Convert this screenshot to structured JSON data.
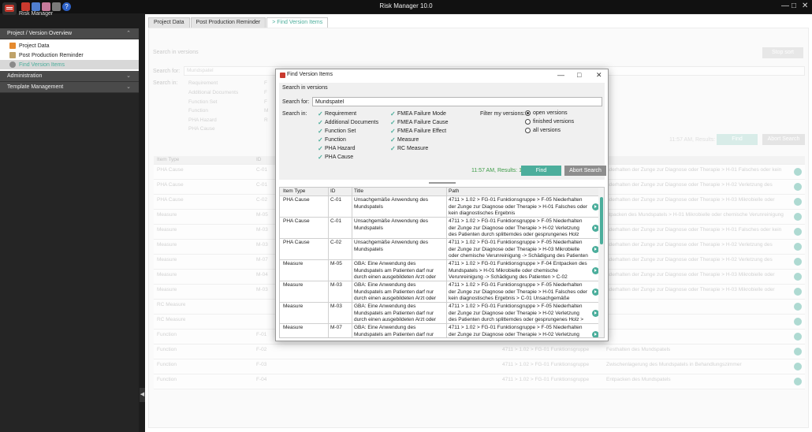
{
  "window": {
    "title": "Risk Manager  10.0",
    "app_name": "Risk Manager"
  },
  "sidebar": {
    "sections": [
      {
        "label": "Project / Version Overview",
        "expanded": true
      },
      {
        "label": "Administration",
        "expanded": false
      },
      {
        "label": "Template Management",
        "expanded": false
      }
    ],
    "items": [
      {
        "label": "Project Data",
        "active": false
      },
      {
        "label": "Post Production Reminder",
        "active": false
      },
      {
        "label": "Find Version Items",
        "active": true
      }
    ]
  },
  "tabs": [
    {
      "label": "Project Data",
      "active": false
    },
    {
      "label": "Post Production Reminder",
      "active": false
    },
    {
      "label": "> Find Version Items",
      "active": true
    }
  ],
  "background": {
    "section_title": "Search in versions",
    "stop_sort": "Stop sort",
    "search_for_label": "Search for:",
    "search_value": "Mundspatel",
    "search_in_label": "Search in:",
    "checks": [
      "Requirement",
      "Additional Documents",
      "Function Set",
      "Function",
      "PHA Hazard",
      "PHA Cause"
    ],
    "checks_col2": [
      "F",
      "F",
      "F",
      "M",
      "R"
    ],
    "status": "11:57 AM, Results: 16",
    "find": "Find",
    "abort": "Abort Search",
    "grid": {
      "headers": [
        "Item Type",
        "ID"
      ],
      "rows": [
        [
          "PHA Cause",
          "C-01",
          "nderhalten der Zunge zur Diagnose oder Therapie > H-01 Falsches oder kein"
        ],
        [
          "PHA Cause",
          "C-01",
          "nderhalten der Zunge zur Diagnose oder Therapie > H-02 Verletzung des"
        ],
        [
          "PHA Cause",
          "C-02",
          "nderhalten der Zunge zur Diagnose oder Therapie > H-03 Mikrobielle oder"
        ],
        [
          "Measure",
          "M-05",
          "ntpacken des Mundspatels > H-01 Mikrobielle oder chemische Verunreinigung"
        ],
        [
          "Measure",
          "M-03",
          "nderhalten der Zunge zur Diagnose oder Therapie > H-01 Falsches oder kein"
        ],
        [
          "Measure",
          "M-03",
          "nderhalten der Zunge zur Diagnose oder Therapie > H-02 Verletzung des"
        ],
        [
          "Measure",
          "M-07",
          "nderhalten der Zunge zur Diagnose oder Therapie > H-02 Verletzung des"
        ],
        [
          "Measure",
          "M-04",
          "nderhalten der Zunge zur Diagnose oder Therapie > H-03 Mikrobielle oder"
        ],
        [
          "Measure",
          "M-03",
          "nderhalten der Zunge zur Diagnose oder Therapie > H-03 Mikrobielle oder"
        ],
        [
          "RC Measure",
          "",
          ""
        ],
        [
          "RC Measure",
          "",
          ""
        ],
        [
          "Function",
          "F-01",
          ""
        ],
        [
          "Function",
          "F-02",
          "Festhalten des Mundspatels"
        ],
        [
          "Function",
          "F-03",
          "Zwischenlagerung des Mundspatels in Behandlungszimmer"
        ],
        [
          "Function",
          "F-04",
          "Entpacken des Mundspatels"
        ]
      ],
      "paths": [
        "",
        "",
        "",
        "",
        "",
        "",
        "",
        "",
        "",
        "",
        "",
        "",
        "4711 > 1.02 > FG-01 Funktionsgruppe",
        "4711 > 1.02 > FG-01 Funktionsgruppe",
        "4711 > 1.02 > FG-01 Funktionsgruppe"
      ]
    }
  },
  "dialog": {
    "title": "Find Version Items",
    "section_title": "Search in versions",
    "search_for_label": "Search for:",
    "search_value": "Mundspatel",
    "search_in_label": "Search in:",
    "checks_col1": [
      "Requirement",
      "Additional Documents",
      "Function Set",
      "Function",
      "PHA Hazard",
      "PHA Cause"
    ],
    "checks_col2": [
      "FMEA Failure Mode",
      "FMEA Failure Cause",
      "FMEA Failure Effect",
      "Measure",
      "RC Measure"
    ],
    "filter_label": "Filter my versions:",
    "filter_options": [
      {
        "label": "open versions",
        "selected": true
      },
      {
        "label": "finished versions",
        "selected": false
      },
      {
        "label": "all versions",
        "selected": false
      }
    ],
    "status": "11:57 AM, Results: 16",
    "find": "Find",
    "abort": "Abort Search",
    "results": {
      "headers": [
        "Item Type",
        "ID",
        "Title",
        "Path"
      ],
      "rows": [
        {
          "type": "PHA Cause",
          "id": "C-01",
          "title": "Unsachgemäße Anwendung des Mundspatels",
          "path": "4711 > 1.02 > FG-01 Funktionsgruppe > F-05 Niederhalten der Zunge zur Diagnose oder Therapie > H-01 Falsches oder kein diagnostisches Ergebnis"
        },
        {
          "type": "PHA Cause",
          "id": "C-01",
          "title": "Unsachgemäße Anwendung des Mundspatels",
          "path": "4711 > 1.02 > FG-01 Funktionsgruppe > F-05 Niederhalten der Zunge zur Diagnose oder Therapie > H-02 Verletzung des Patienten durch splitterndes oder gesprungenes Holz"
        },
        {
          "type": "PHA Cause",
          "id": "C-02",
          "title": "Unsachgemäße Anwendung des Mundspatels",
          "path": "4711 > 1.02 > FG-01 Funktionsgruppe > F-05 Niederhalten der Zunge zur Diagnose oder Therapie > H-03 Mikrobielle oder chemische Verunreinigung -> Schädigung des Patienten"
        },
        {
          "type": "Measure",
          "id": "M-05",
          "title": "GBA: Eine Anwendung des Mundspatels am Patienten darf nur durch einen ausgebildeten Arzt oder Person mit ver...",
          "path": "4711 > 1.02 > FG-01 Funktionsgruppe > F-04 Entpacken des Mundspatels > H-01 Mikrobielle oder chemische Verunreinigung -> Schädigung des Patienten > C-02 Unsach..."
        },
        {
          "type": "Measure",
          "id": "M-03",
          "title": "GBA: Eine Anwendung des Mundspatels am Patienten darf nur durch einen ausgebildeten Arzt oder Person mit ver...",
          "path": "4711 > 1.02 > FG-01 Funktionsgruppe > F-05 Niederhalten der Zunge zur Diagnose oder Therapie > H-01 Falsches oder kein diagnostisches Ergebnis > C-01 Unsachgemäße Anwen..."
        },
        {
          "type": "Measure",
          "id": "M-03",
          "title": "GBA: Eine Anwendung des Mundspatels am Patienten darf nur durch einen ausgebildeten Arzt oder Person mit ver...",
          "path": "4711 > 1.02 > FG-01 Funktionsgruppe > F-05 Niederhalten der Zunge zur Diagnose oder Therapie > H-02 Verletzung des Patienten durch splitterndes oder gesprungenes Holz > C-01..."
        },
        {
          "type": "Measure",
          "id": "M-07",
          "title": "GBA: Eine Anwendung des Mundspatels am Patienten darf nur durch einen",
          "path": "4711 > 1.02 > FG-01 Funktionsgruppe > F-05 Niederhalten der Zunge zur Diagnose oder Therapie > H-02 Verletzung des"
        }
      ]
    }
  },
  "colors": {
    "accent": "#4cae9c",
    "status_green": "#3c9b46",
    "brand_red": "#c93a2e"
  }
}
